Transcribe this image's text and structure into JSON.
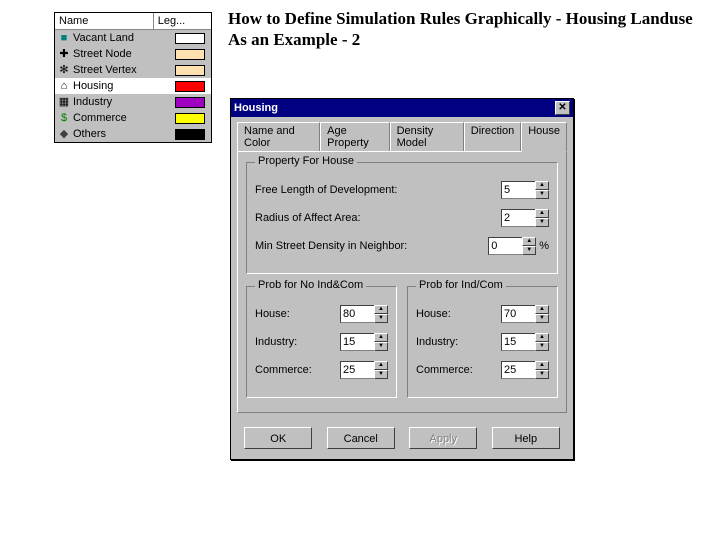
{
  "heading": "How to Define Simulation Rules Graphically - Housing Landuse As an Example - 2",
  "legend": {
    "columns": {
      "name": "Name",
      "color": "Leg..."
    },
    "items": [
      {
        "icon": "■",
        "icon_color": "#008080",
        "label": "Vacant Land",
        "swatch": "#ffffff"
      },
      {
        "icon": "✚",
        "icon_color": "#000000",
        "label": "Street Node",
        "swatch": "#ffe0b0"
      },
      {
        "icon": "✻",
        "icon_color": "#000000",
        "label": "Street Vertex",
        "swatch": "#ffe0b0"
      },
      {
        "icon": "⌂",
        "icon_color": "#000000",
        "label": "Housing",
        "swatch": "#ff0000",
        "selected": true
      },
      {
        "icon": "▦",
        "icon_color": "#000000",
        "label": "Industry",
        "swatch": "#a000c0"
      },
      {
        "icon": "$",
        "icon_color": "#008000",
        "label": "Commerce",
        "swatch": "#ffff00"
      },
      {
        "icon": "◆",
        "icon_color": "#404040",
        "label": "Others",
        "swatch": "#000000"
      }
    ]
  },
  "dialog": {
    "title": "Housing",
    "close": "✕",
    "tabs": [
      "Name and Color",
      "Age Property",
      "Density Model",
      "Direction",
      "House"
    ],
    "active_tab": 4,
    "group_property": {
      "title": "Property For House",
      "fields": [
        {
          "label": "Free Length of Development:",
          "value": "5"
        },
        {
          "label": "Radius of Affect Area:",
          "value": "2"
        },
        {
          "label": "Min Street Density in Neighbor:",
          "value": "0",
          "suffix": "%"
        }
      ]
    },
    "group_prob_no": {
      "title": "Prob for No Ind&Com",
      "fields": [
        {
          "label": "House:",
          "value": "80"
        },
        {
          "label": "Industry:",
          "value": "15"
        },
        {
          "label": "Commerce:",
          "value": "25"
        }
      ]
    },
    "group_prob_ind": {
      "title": "Prob for Ind/Com",
      "fields": [
        {
          "label": "House:",
          "value": "70"
        },
        {
          "label": "Industry:",
          "value": "15"
        },
        {
          "label": "Commerce:",
          "value": "25"
        }
      ]
    },
    "buttons": {
      "ok": "OK",
      "cancel": "Cancel",
      "apply": "Apply",
      "help": "Help"
    }
  }
}
